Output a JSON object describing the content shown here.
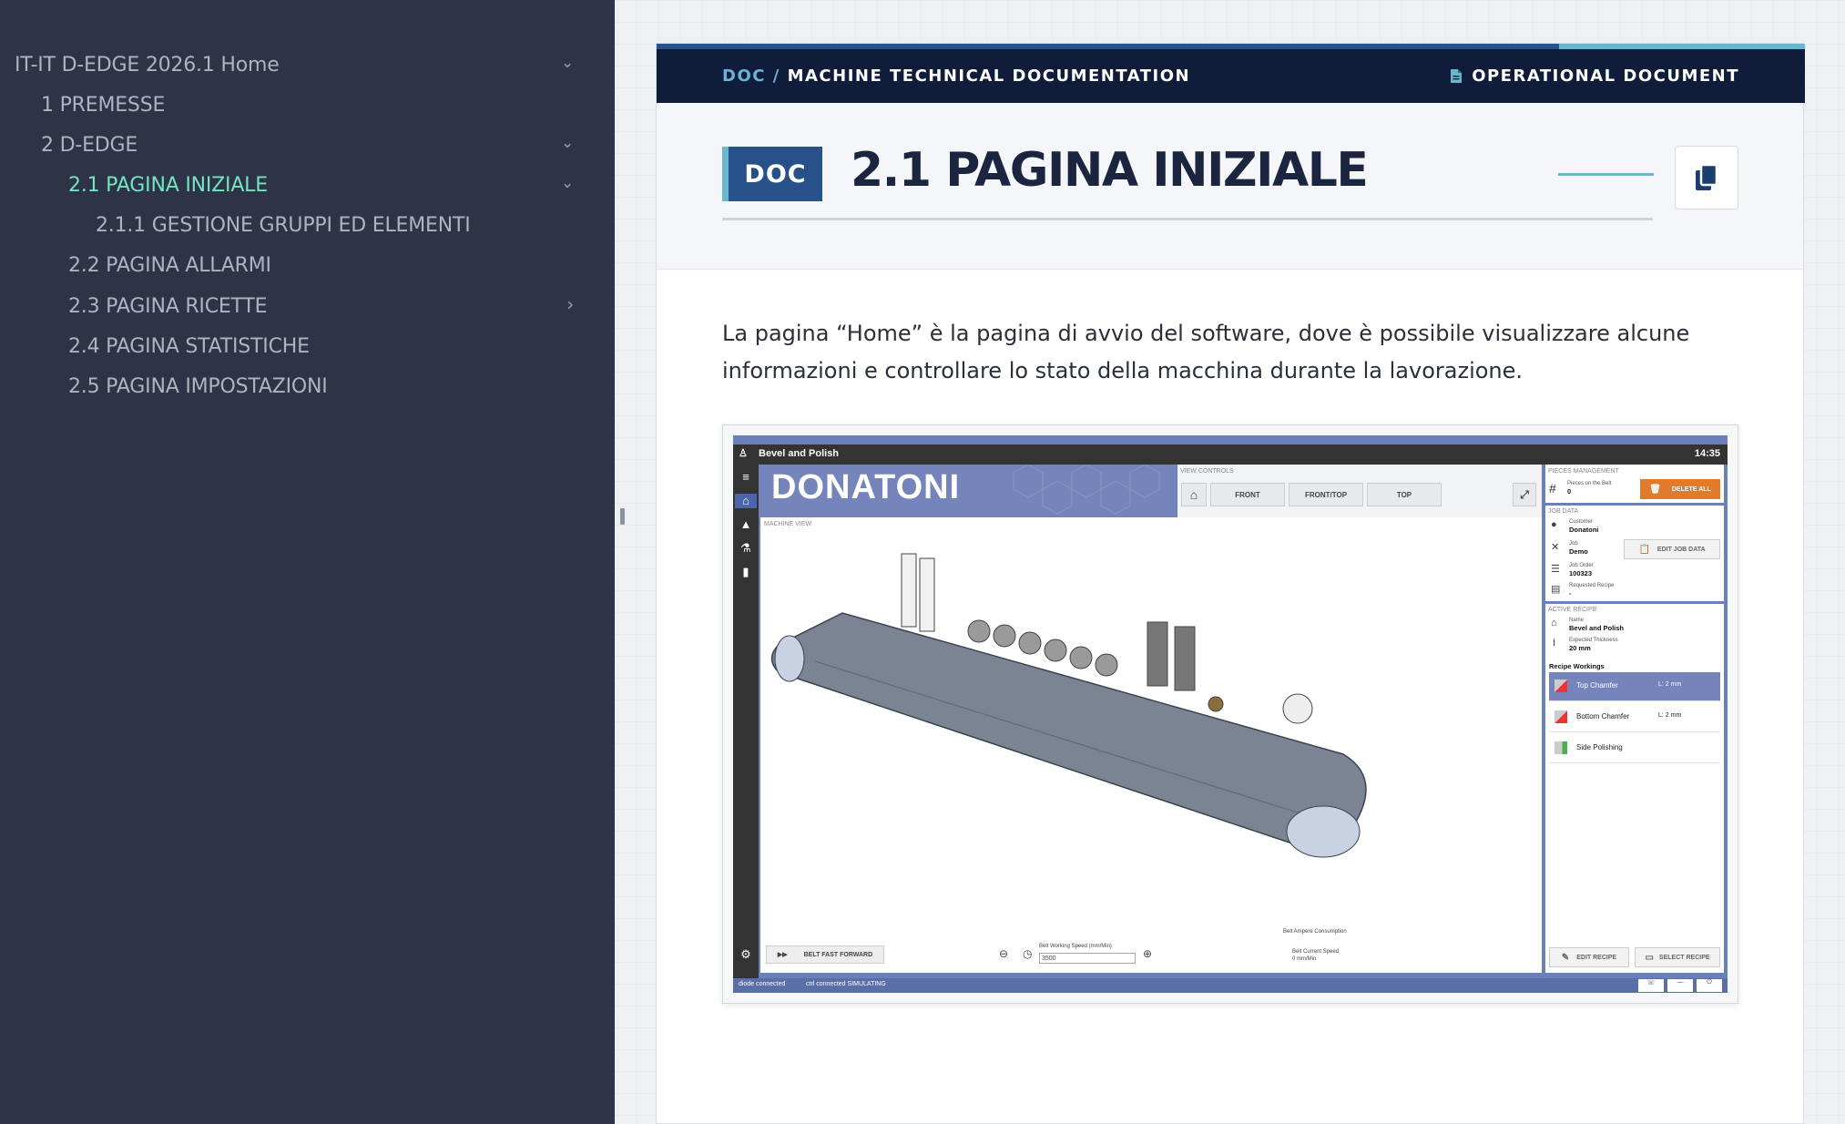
{
  "sidebar": {
    "items": [
      {
        "label": "IT-IT D-EDGE 2026.1 Home",
        "chevron": "⌄",
        "active": false
      },
      {
        "label": "1 PREMESSE",
        "chevron": "",
        "active": false
      },
      {
        "label": "2 D-EDGE",
        "chevron": "⌄",
        "active": false
      },
      {
        "label": "2.1 PAGINA INIZIALE",
        "chevron": "⌄",
        "active": true
      },
      {
        "label": "2.1.1 GESTIONE GRUPPI ED ELEMENTI",
        "chevron": "",
        "active": false
      },
      {
        "label": "2.2 PAGINA ALLARMI",
        "chevron": "",
        "active": false
      },
      {
        "label": "2.3 PAGINA RICETTE",
        "chevron": "›",
        "active": false
      },
      {
        "label": "2.4 PAGINA STATISTICHE",
        "chevron": "",
        "active": false
      },
      {
        "label": "2.5 PAGINA IMPOSTAZIONI",
        "chevron": "",
        "active": false
      }
    ]
  },
  "doc": {
    "breadcrumb_prefix": "DOC /",
    "breadcrumb_title": "MACHINE TECHNICAL DOCUMENTATION",
    "doc_type": "OPERATIONAL DOCUMENT",
    "badge": "DOC",
    "title": "2.1 PAGINA INIZIALE",
    "intro": "La pagina “Home” è la pagina di avvio del software, dove è possibile visualizzare alcune informazioni e controllare lo stato della macchina durante la lavorazione."
  },
  "screenshot": {
    "app_title": "Bevel and Polish",
    "clock": "14:35",
    "logo": "DONATONI",
    "view_controls": {
      "label": "VIEW CONTROLS",
      "buttons": [
        "FRONT",
        "FRONT/TOP",
        "TOP"
      ]
    },
    "machine_view_label": "MACHINE VIEW",
    "pieces": {
      "label": "PIECES MANAGEMENT",
      "pieces_label": "Pieces on the Belt",
      "pieces_value": "0",
      "delete_label": "DELETE ALL"
    },
    "job": {
      "label": "JOB DATA",
      "customer_label": "Customer",
      "customer_value": "Donatoni",
      "job_label": "Job",
      "job_value": "Demo",
      "order_label": "Job Order",
      "order_value": "100323",
      "recipe_label": "Requested Recipe",
      "recipe_value": "-",
      "edit_label": "EDIT JOB DATA"
    },
    "active_recipe": {
      "label": "ACTIVE RECIPE",
      "name_label": "Name",
      "name_value": "Bevel and Polish",
      "thickness_label": "Expected Thickness",
      "thickness_value": "20 mm",
      "workings_label": "Recipe Workings",
      "workings": [
        {
          "name": "Top Chamfer",
          "value": "L: 2 mm",
          "selected": true
        },
        {
          "name": "Bottom Chamfer",
          "value": "L: 2 mm",
          "selected": false
        },
        {
          "name": "Side Polishing",
          "value": "",
          "selected": false
        }
      ]
    },
    "bottom": {
      "fast_forward": "BELT FAST FORWARD",
      "speed_label": "Belt Working Speed (mm/Min)",
      "speed_value": "3500",
      "ampere_label": "Belt Ampere Consumption",
      "current_speed_label": "Belt Current Speed",
      "current_speed_value": "0 mm/Min",
      "edit_recipe": "EDIT RECIPE",
      "select_recipe": "SELECT RECIPE"
    },
    "status": {
      "diode": "diode connected",
      "ctrl": "ctrl connected SIMULATING"
    }
  }
}
